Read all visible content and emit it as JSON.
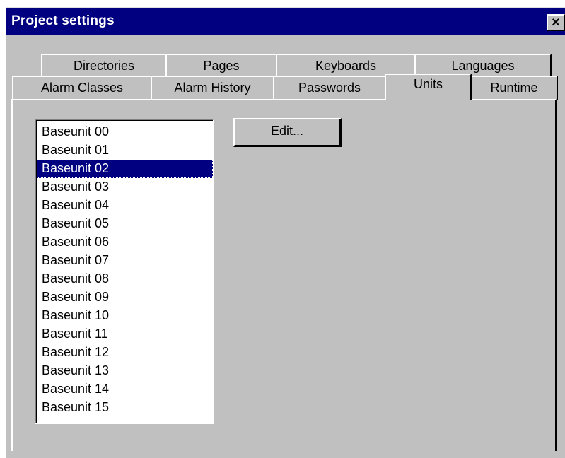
{
  "window": {
    "title": "Project settings",
    "close_label": "×",
    "close_icon": "close-icon"
  },
  "tabs": {
    "back_row": [
      {
        "label": "Directories"
      },
      {
        "label": "Pages"
      },
      {
        "label": "Keyboards"
      },
      {
        "label": "Languages"
      }
    ],
    "front_row": [
      {
        "label": "Alarm Classes"
      },
      {
        "label": "Alarm History"
      },
      {
        "label": "Passwords"
      },
      {
        "label": "Units"
      },
      {
        "label": "Runtime"
      }
    ],
    "active": "Units"
  },
  "units_list": {
    "selected": "Baseunit 02",
    "items": [
      "Baseunit 00",
      "Baseunit 01",
      "Baseunit 02",
      "Baseunit 03",
      "Baseunit 04",
      "Baseunit 05",
      "Baseunit 06",
      "Baseunit 07",
      "Baseunit 08",
      "Baseunit 09",
      "Baseunit 10",
      "Baseunit 11",
      "Baseunit 12",
      "Baseunit 13",
      "Baseunit 14",
      "Baseunit 15"
    ]
  },
  "buttons": {
    "edit_label": "Edit..."
  },
  "colors": {
    "titlebar": "#000080",
    "face": "#c0c0c0",
    "selection": "#000080"
  }
}
